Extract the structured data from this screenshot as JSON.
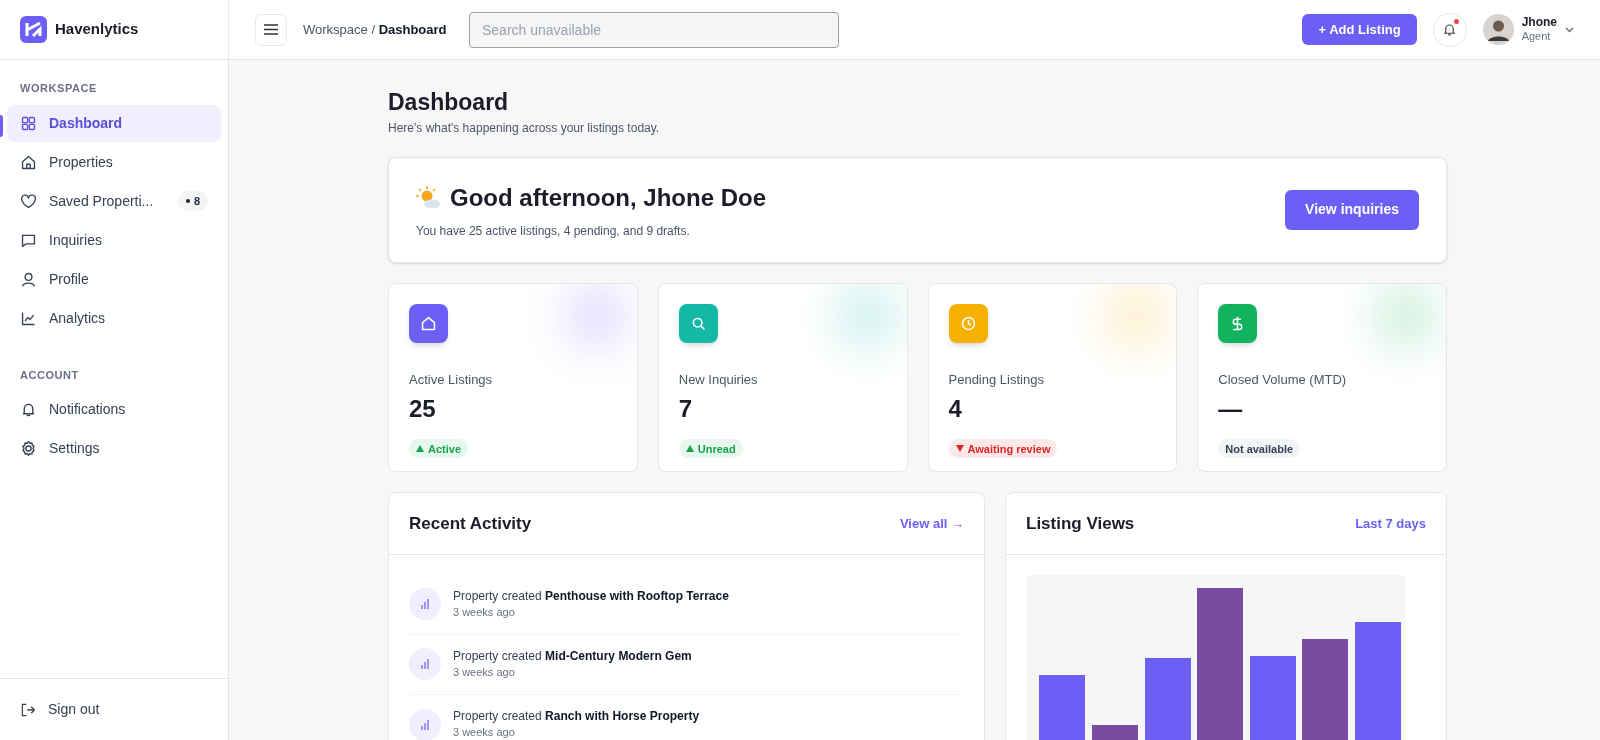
{
  "brand": {
    "name": "Havenlytics"
  },
  "topbar": {
    "breadcrumb": {
      "parent": "Workspace /",
      "current": "Dashboard"
    },
    "search": {
      "placeholder": "Search unavailable"
    },
    "add_button": "+ Add Listing",
    "notifications": {
      "unread": true
    },
    "user": {
      "name": "Jhone",
      "role": "Agent"
    }
  },
  "sidebar": {
    "sections": [
      {
        "title": "WORKSPACE",
        "items": [
          {
            "label": "Dashboard",
            "selected": true
          },
          {
            "label": "Properties",
            "selected": false
          },
          {
            "label": "Saved Properti...",
            "selected": false,
            "badge": "8"
          },
          {
            "label": "Inquiries",
            "selected": false
          },
          {
            "label": "Profile",
            "selected": false
          },
          {
            "label": "Analytics",
            "selected": false
          }
        ]
      },
      {
        "title": "ACCOUNT",
        "items": [
          {
            "label": "Notifications",
            "selected": false
          },
          {
            "label": "Settings",
            "selected": false
          }
        ]
      }
    ],
    "sign_out": "Sign out"
  },
  "page": {
    "title": "Dashboard",
    "subtitle": "Here's what's happening across your listings today."
  },
  "greeting": {
    "title": "Good afternoon, Jhone Doe",
    "text": "You have 25 active listings, 4 pending, and 9 drafts.",
    "button": "View inquiries"
  },
  "stats": [
    {
      "label": "Active Listings",
      "value": "25",
      "badge": "Active",
      "kind": "up",
      "color": "#6c5ff6"
    },
    {
      "label": "New Inquiries",
      "value": "7",
      "badge": "Unread",
      "kind": "up",
      "color": "#14b8a6"
    },
    {
      "label": "Pending Listings",
      "value": "4",
      "badge": "Awaiting review",
      "kind": "down",
      "color": "#f5b000"
    },
    {
      "label": "Closed Volume (MTD)",
      "value": "—",
      "badge": "Not available",
      "kind": "neutral",
      "color": "#12b35f"
    }
  ],
  "activity": {
    "title": "Recent Activity",
    "link": "View all →",
    "items": [
      {
        "text": "Property created **Penthouse with Rooftop Terrace**",
        "time": "3 weeks ago"
      },
      {
        "text": "Property created **Mid-Century Modern Gem**",
        "time": "3 weeks ago"
      },
      {
        "text": "Property created **Ranch with Horse Property**",
        "time": "3 weeks ago"
      }
    ]
  },
  "views": {
    "title": "Listing Views",
    "range": "Last 7 days"
  }
}
